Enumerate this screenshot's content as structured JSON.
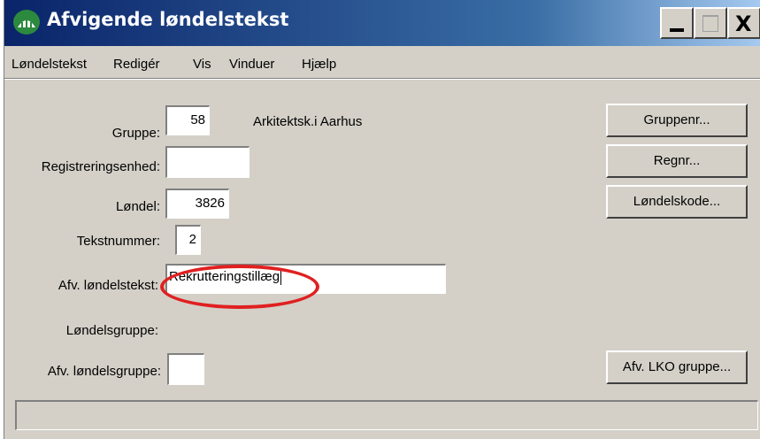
{
  "window": {
    "title": "Afvigende løndelstekst",
    "controls": {
      "minimize": "_",
      "maximize": "",
      "close": "X"
    }
  },
  "menubar": [
    "Løndelstekst",
    "Redigér",
    "Vis",
    "Vinduer",
    "Hjælp"
  ],
  "form": {
    "gruppe": {
      "label": "Gruppe:",
      "value": "58",
      "description": "Arkitektsk.i Aarhus"
    },
    "registreringsenhed": {
      "label": "Registreringsenhed:",
      "value": ""
    },
    "loendel": {
      "label": "Løndel:",
      "value": "3826"
    },
    "tekstnummer": {
      "label": "Tekstnummer:",
      "value": "2"
    },
    "afv_loendelstekst": {
      "label": "Afv. løndelstekst:",
      "value": "Rekrutteringstillæg"
    },
    "loendelsgruppe": {
      "label": "Løndelsgruppe:"
    },
    "afv_loendelsgruppe": {
      "label": "Afv. løndelsgruppe:",
      "value": ""
    }
  },
  "buttons": {
    "gruppenr": "Gruppenr...",
    "regnr": "Regnr...",
    "loendelskode": "Løndelskode...",
    "afv_lko_gruppe": "Afv. LKO gruppe..."
  },
  "statusbar": {
    "text": ""
  },
  "annotation": {
    "color": "#e02020"
  }
}
